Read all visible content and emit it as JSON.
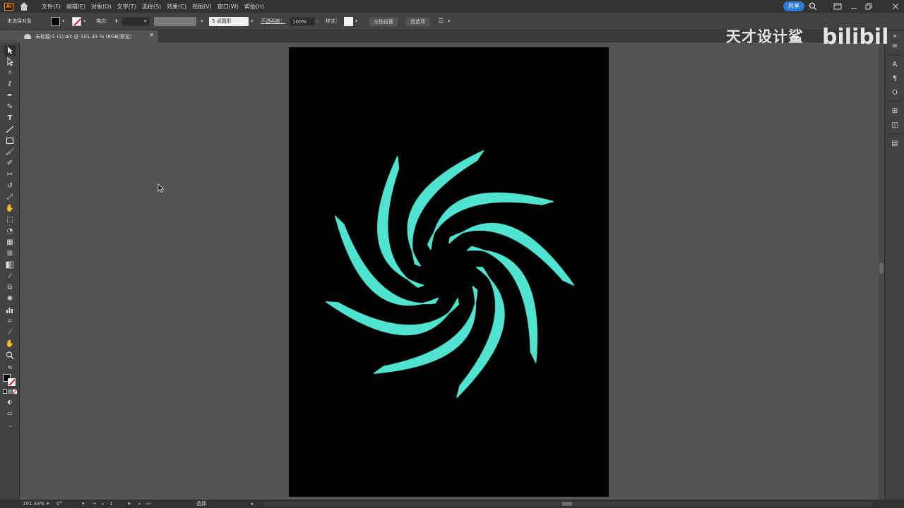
{
  "menubar": {
    "app_logo": "Ai",
    "items": [
      "文件(F)",
      "编辑(E)",
      "对象(O)",
      "文字(T)",
      "选择(S)",
      "效果(C)",
      "视图(V)",
      "窗口(W)",
      "帮助(H)"
    ],
    "share_label": "共享",
    "icons": [
      "search-icon",
      "arrange-documents-icon",
      "minimize-icon",
      "restore-icon",
      "close-icon"
    ]
  },
  "controlbar": {
    "selection_label": "未选择对象",
    "stroke_label": "描边：",
    "brush_label": "5 点圆形",
    "opacity_label": "不透明度：",
    "opacity_value": "100%",
    "style_label": "样式：",
    "doc_settings_label": "文档设置",
    "preferences_label": "首选项"
  },
  "watermark": {
    "text": "天才设计鲨",
    "logo": "bilibili"
  },
  "document_tab": {
    "label": "未标题-1 (1).aic @ 101.33 % (RGB/预览)",
    "close": "×"
  },
  "tools": [
    "selection-tool-icon",
    "direct-selection-tool-icon",
    "magic-wand-tool-icon",
    "lasso-tool-icon",
    "pen-tool-icon",
    "curvature-tool-icon",
    "type-tool-icon",
    "line-tool-icon",
    "rectangle-tool-icon",
    "paintbrush-tool-icon",
    "shaper-tool-icon",
    "scissors-tool-icon",
    "rotate-tool-icon",
    "scale-tool-icon",
    "warp-tool-icon",
    "free-transform-tool-icon",
    "shape-builder-tool-icon",
    "perspective-grid-tool-icon",
    "mesh-tool-icon",
    "gradient-tool-icon",
    "eyedropper-tool-icon",
    "blend-tool-icon",
    "symbol-sprayer-tool-icon",
    "column-graph-tool-icon",
    "artboard-tool-icon",
    "slice-tool-icon",
    "hand-tool-icon",
    "zoom-tool-icon"
  ],
  "artwork": {
    "background": "#000000",
    "swirl_color": "#4fe3d0"
  },
  "statusbar": {
    "zoom": "101.33%",
    "rotation": "0°",
    "artboard_number": "1",
    "mode": "选择"
  }
}
